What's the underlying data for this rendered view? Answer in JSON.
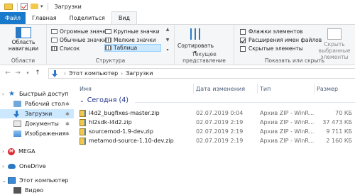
{
  "window": {
    "title": "Загрузки"
  },
  "ribbon_tabs": [
    "Файл",
    "Главная",
    "Поделиться",
    "Вид"
  ],
  "ribbon": {
    "areas_group": {
      "nav_pane_label": "Область навигации",
      "group_label": "Области"
    },
    "structure_group": {
      "items": [
        "Огромные значки",
        "Крупные значки",
        "Обычные значки",
        "Мелкие значки",
        "Список",
        "Таблица"
      ],
      "selected": "Таблица",
      "group_label": "Структура"
    },
    "current_view_group": {
      "sort_label": "Сортировать",
      "group_label": "Текущее представление"
    },
    "show_hide_group": {
      "checkboxes": [
        {
          "label": "Флажки элементов",
          "checked": false
        },
        {
          "label": "Расширения имен файлов",
          "checked": true
        },
        {
          "label": "Скрытые элементы",
          "checked": false
        }
      ],
      "hide_selected_label": "Скрыть выбранные элементы",
      "group_label": "Показать или скрыть"
    }
  },
  "address_bar": {
    "path": [
      "Этот компьютер",
      "Загрузки"
    ]
  },
  "nav_pane": {
    "items": [
      {
        "label": "Быстрый доступ",
        "icon": "star-icon"
      },
      {
        "label": "Рабочий стол",
        "icon": "desktop-folder-icon"
      },
      {
        "label": "Загрузки",
        "icon": "downloads-folder-icon"
      },
      {
        "label": "Документы",
        "icon": "documents-folder-icon"
      },
      {
        "label": "Изображения",
        "icon": "pictures-folder-icon"
      },
      {
        "label": "MEGA",
        "icon": "mega-icon"
      },
      {
        "label": "OneDrive",
        "icon": "onedrive-icon"
      },
      {
        "label": "Этот компьютер",
        "icon": "computer-icon"
      },
      {
        "label": "Видео",
        "icon": "videos-folder-icon"
      }
    ],
    "selected": "Загрузки"
  },
  "columns": [
    "Имя",
    "Дата изменения",
    "Тип",
    "Размер"
  ],
  "group": {
    "label": "Сегодня (4)"
  },
  "files": [
    {
      "name": "l4d2_bugfixes-master.zip",
      "date": "02.07.2019 0:04",
      "type": "Архив ZIP - WinR...",
      "size": "70 КБ"
    },
    {
      "name": "hl2sdk-l4d2.zip",
      "date": "02.07.2019 2:19",
      "type": "Архив ZIP - WinR...",
      "size": "37 473 КБ"
    },
    {
      "name": "sourcemod-1.9-dev.zip",
      "date": "02.07.2019 2:19",
      "type": "Архив ZIP - WinR...",
      "size": "9 711 КБ"
    },
    {
      "name": "metamod-source-1.10-dev.zip",
      "date": "02.07.2019 2:19",
      "type": "Архив ZIP - WinR...",
      "size": "2 160 КБ"
    }
  ],
  "colors": {
    "file_tab": "#1979ca",
    "selection": "#cce8ff",
    "group_header": "#1e3287"
  }
}
